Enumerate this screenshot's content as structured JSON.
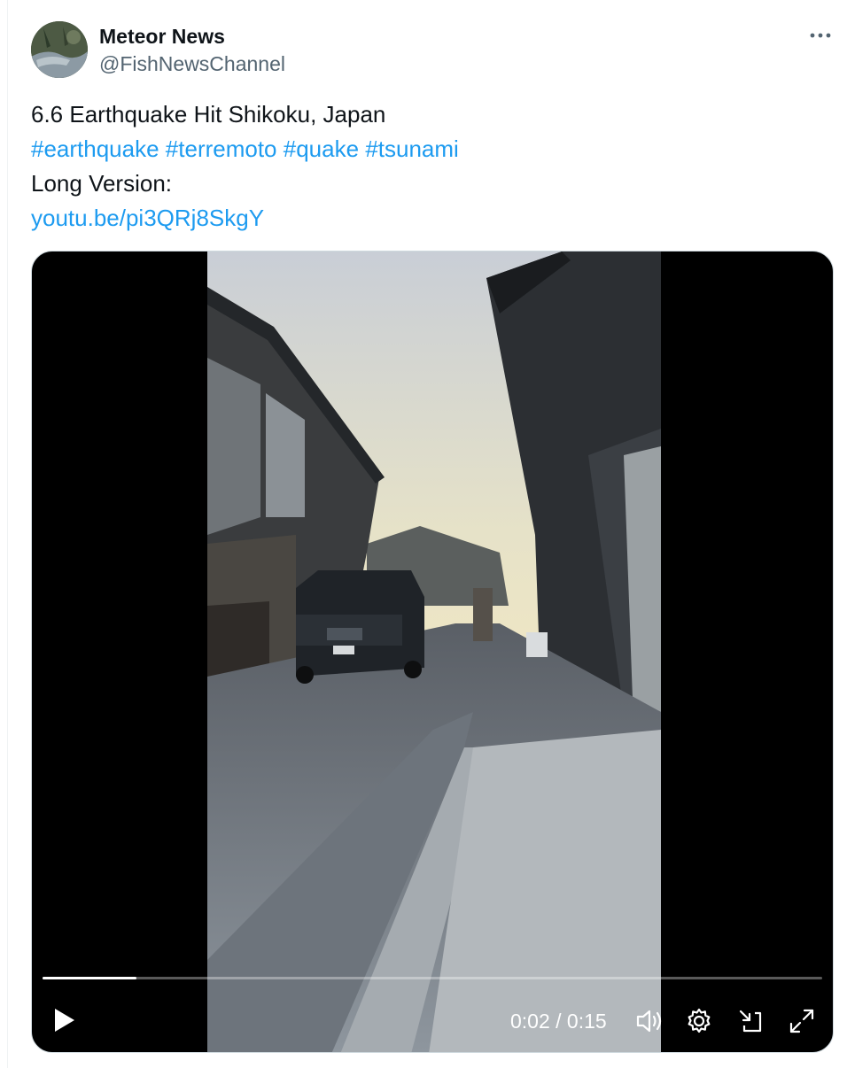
{
  "author": {
    "display_name": "Meteor News",
    "handle": "@FishNewsChannel"
  },
  "tweet": {
    "text_line": "6.6 Earthquake Hit Shikoku, Japan",
    "hashtags": [
      "#earthquake",
      "#terremoto",
      "#quake",
      "#tsunami"
    ],
    "long_version_label": "Long Version:",
    "link": "youtu.be/pi3QRj8SkgY"
  },
  "video": {
    "current_time": "0:02",
    "duration": "0:15",
    "time_display": "0:02 / 0:15",
    "progress_fraction": 0.12
  },
  "icons": {
    "more": "more-horizontal-icon",
    "play": "play-icon",
    "volume": "volume-icon",
    "settings": "gear-icon",
    "pip": "picture-in-picture-icon",
    "fullscreen": "expand-icon"
  },
  "colors": {
    "link": "#1d9bf0",
    "text": "#0f1419",
    "secondary": "#536471"
  }
}
